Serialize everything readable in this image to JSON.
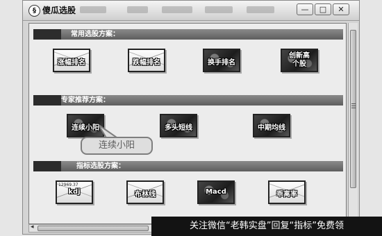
{
  "window": {
    "title": "傻瓜选股",
    "icon_glyph": "§",
    "min_glyph": "—",
    "max_glyph": "□",
    "close_glyph": "✕"
  },
  "sections": [
    {
      "title": "常用选股方案：",
      "items": [
        {
          "label": "涨幅排名",
          "style": "light"
        },
        {
          "label": "跌幅排名",
          "style": "light"
        },
        {
          "label": "换手排名",
          "style": "dark"
        },
        {
          "label": "创新高个股",
          "style": "dark"
        }
      ]
    },
    {
      "title": "专家推荐方案：",
      "items": [
        {
          "label": "连续小阳",
          "style": "dark"
        },
        {
          "label": "多头短线",
          "style": "dark"
        },
        {
          "label": "中期均线",
          "style": "dark"
        }
      ]
    },
    {
      "title": "指标选股方案：",
      "items": [
        {
          "label": "kdj",
          "style": "light",
          "extra": "12969.37"
        },
        {
          "label": "布林线",
          "style": "light"
        },
        {
          "label": "Macd",
          "style": "dark"
        },
        {
          "label": "乖离率",
          "style": "light"
        }
      ]
    }
  ],
  "callout": {
    "text": "连续小阳"
  },
  "scrollbar": {
    "h_left_arrow": "◂"
  },
  "watermark": {
    "text": "关注微信“老韩实盘”回复“指标”免费领"
  }
}
